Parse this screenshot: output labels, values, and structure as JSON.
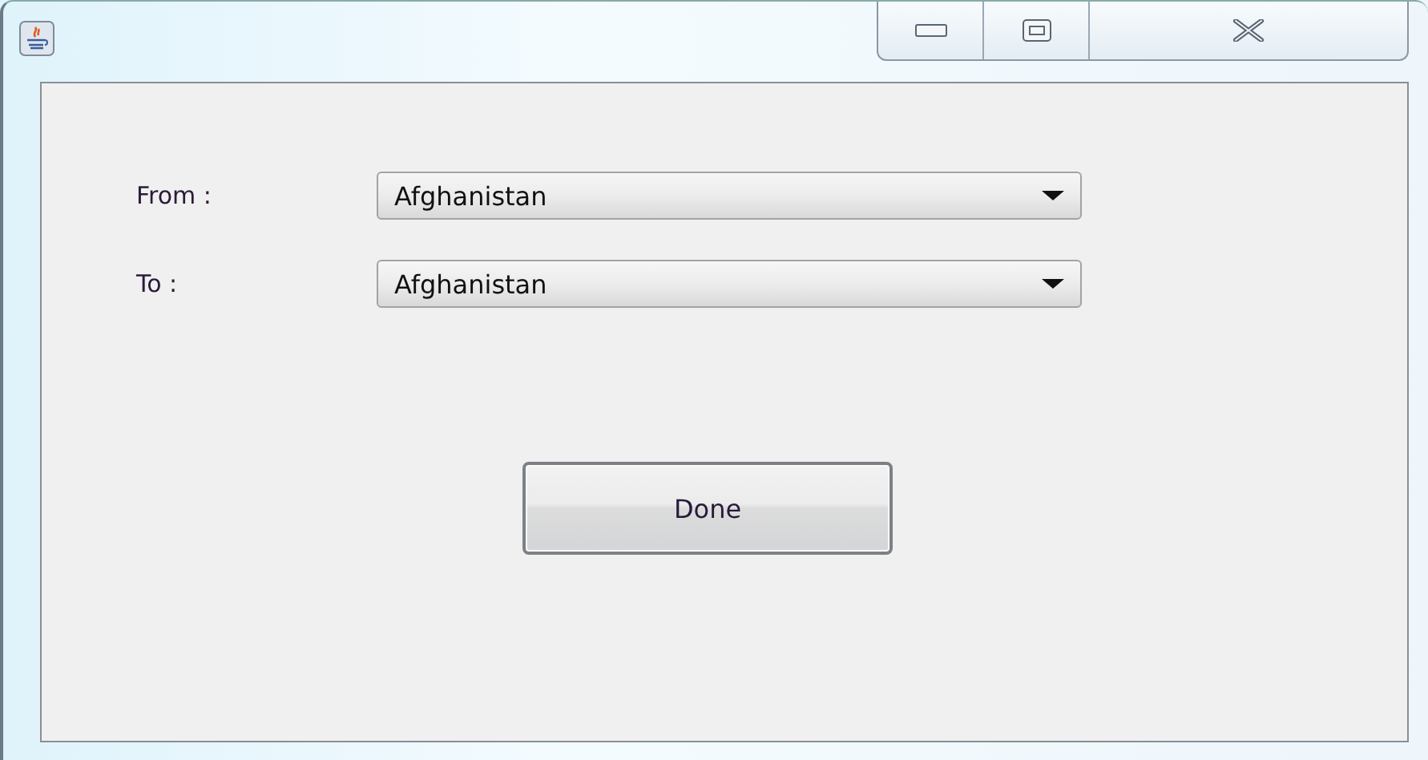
{
  "fields": [
    {
      "label": "From :",
      "value": "Afghanistan"
    },
    {
      "label": "To :",
      "value": "Afghanistan"
    }
  ],
  "buttons": [
    {
      "label": "Done"
    }
  ]
}
